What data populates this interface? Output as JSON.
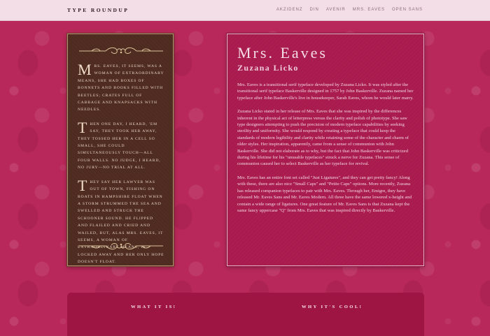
{
  "header": {
    "brand": "TYPE ROUNDUP",
    "nav": [
      "AKZIDENZ",
      "DIN",
      "AVENIR",
      "MRS. EAVES",
      "OPEN SANS"
    ]
  },
  "poem": {
    "paragraphs": [
      {
        "cap": "M",
        "text": "rs. Eaves, it seems, was a woman of extraordinary means, she had boxes of bonnets and books filled with beetles; crates full of cabbage and knapsacks with needles."
      },
      {
        "cap": "T",
        "text": "hen one day, I heard, 'em say, they took her away, they tossed her in a cell so small, she could simultaneously touch—all four walls. No judge, I heard, no jury—no trial at all."
      },
      {
        "cap": "T",
        "text": "hey say her lawyer was out of town, fishing on boats in Hampshire float when a storm strummed the sea and swelled and struck the schooner sound. He flipped and flailed and cried and wailed, but, alas Mrs. Eaves, it seems, a woman of extraordinary means, is locked away and her only hope doesn't float."
      }
    ]
  },
  "article": {
    "title": "Mrs. Eaves",
    "subtitle": "Zuzana Licko",
    "paragraphs": [
      "Mrs. Eaves is a transitional serif typeface developed by Zuzana Licko. It was styled after the transitional serif typeface Baskerville designed in 1757 by John Baskerville. Zuzana named her typeface after John Baskerville's live in housekeeper, Sarah Eaves, whom he would later marry.",
      "Zuzana Licko stated in her release of Mrs. Eaves that she was inspired by the differences inherent in the physical act of letterpress versus the clarity and polish of phototype. She saw type designers attempting to push the precision of modern typeface capabilities by seeking sterility and uniformity. She would respond by creating a typeface that could keep the standards of modern legibility and clarity while retaining some of the character and charm of older styles. Her inspiration, apparently, came from a sense of communion with John Baskerville. She did not elaborate as to why, but the fact that John Baskerville was criticized during his lifetime for his \"unusable typefaces\" struck a nerve for Zuzana. This sense of communion caused her to select Baskerville as her typeface for revival.",
      "Mrs. Eaves has an entire font set called \"Just Ligatures\", and they can get pretty fancy! Along with these, there are also nice \"Small Caps\" and \"Petite Caps\" options. More recently, Zuzana has released companion typefaces to pair with Mrs. Eaves. Through her, Emigre, they have released Mr. Eaves Sans and Mr. Eaves Modern. All three have the same lowered x-height and contain a wide range of ligatures. One great feature of Mr. Eaves Sans is that Zuzana kept the same fancy uppercase \"Q\" from Mrs. Eaves that was inspired directly by Baskerville."
    ]
  },
  "sections": {
    "what": "WHAT IT IS!",
    "why": "WHY IT'S COOL!"
  },
  "icons": {
    "flourish": "ornamental-flourish-icon"
  },
  "colors": {
    "background": "#b8285a",
    "topbar": "#f3dde6",
    "poem_card": "#4e2a1f",
    "article_card": "#a91a4d",
    "bottom_panel": "#9e1544"
  }
}
